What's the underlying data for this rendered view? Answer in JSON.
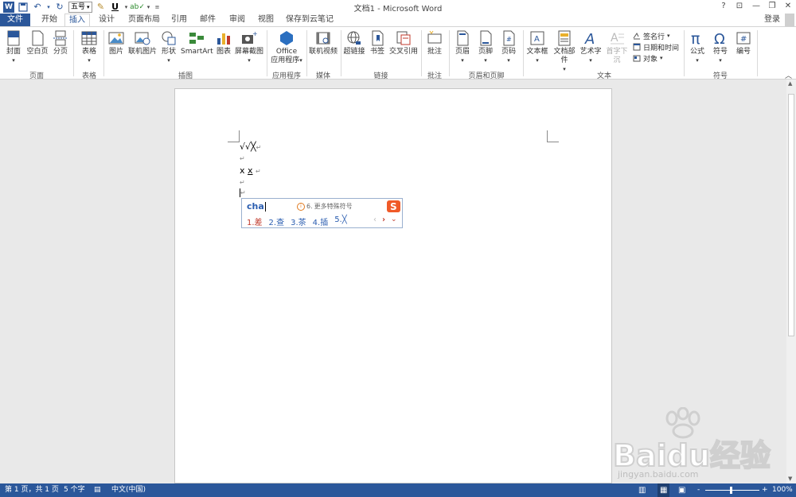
{
  "titlebar": {
    "title": "文档1 - Microsoft Word",
    "font_size_value": "五号",
    "help": "?",
    "restore_ribbon": "⊡",
    "minimize": "—",
    "maximize": "❐",
    "close": "✕"
  },
  "tabs": {
    "file": "文件",
    "home": "开始",
    "insert": "插入",
    "design": "设计",
    "layout": "页面布局",
    "references": "引用",
    "mailings": "邮件",
    "review": "审阅",
    "view": "视图",
    "cloud": "保存到云笔记",
    "login": "登录"
  },
  "ribbon": {
    "pages": {
      "cover": "封面",
      "blank": "空白页",
      "break": "分页",
      "label": "页面"
    },
    "tables": {
      "table": "表格",
      "label": "表格"
    },
    "illustrations": {
      "picture": "图片",
      "online_picture": "联机图片",
      "shapes": "形状",
      "smartart": "SmartArt",
      "chart": "图表",
      "screenshot": "屏幕截图",
      "label": "插图"
    },
    "apps": {
      "office_line1": "Office",
      "office_line2": "应用程序",
      "label": "应用程序"
    },
    "media": {
      "video": "联机视频",
      "label": "媒体"
    },
    "links": {
      "hyperlink": "超链接",
      "bookmark": "书签",
      "crossref": "交叉引用",
      "label": "链接"
    },
    "comments": {
      "comment": "批注",
      "label": "批注"
    },
    "header_footer": {
      "header": "页眉",
      "footer": "页脚",
      "page_number": "页码",
      "label": "页眉和页脚"
    },
    "text": {
      "textbox": "文本框",
      "quickparts": "文档部件",
      "wordart": "艺术字",
      "dropcap": "首字下沉",
      "signature": "签名行",
      "datetime": "日期和时间",
      "object": "对象",
      "label": "文本"
    },
    "symbols": {
      "equation": "公式",
      "symbol": "符号",
      "number": "编号",
      "label": "符号"
    }
  },
  "document": {
    "line1": "√√╳",
    "line3_plain": "x",
    "line3_underlined": "x"
  },
  "ime": {
    "input": "cha",
    "hint_index": "6.",
    "hint_text": "更多特殊符号",
    "candidates": [
      {
        "num": "1.",
        "text": "差"
      },
      {
        "num": "2.",
        "text": "查"
      },
      {
        "num": "3.",
        "text": "茶"
      },
      {
        "num": "4.",
        "text": "插"
      },
      {
        "num": "5.",
        "text": "╳"
      }
    ]
  },
  "statusbar": {
    "page": "第 1 页，共 1 页",
    "words": "5 个字",
    "language": "中文(中国)",
    "zoom": "100%",
    "zoom_minus": "-",
    "zoom_plus": "+"
  },
  "watermark": {
    "brand": "Baidu经验",
    "url": "jingyan.baidu.com"
  },
  "colors": {
    "accent": "#2b579a",
    "ime_red": "#c0392b",
    "ime_blue": "#2a5db0",
    "sogou_orange": "#f05a28"
  }
}
